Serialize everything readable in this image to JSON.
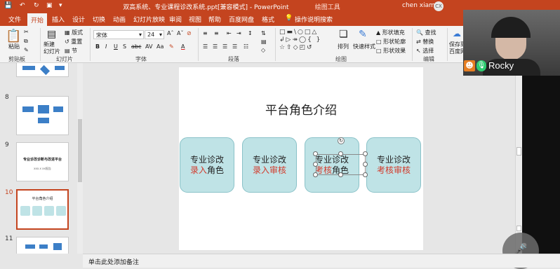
{
  "window": {
    "title": "双高系统、专业课程诊改系统.ppt[兼容模式] - PowerPoint",
    "contextual_tab": "绘图工具",
    "user": "chen xiamei",
    "user_initials": "CX"
  },
  "tabs": [
    "文件",
    "开始",
    "插入",
    "设计",
    "切换",
    "动画",
    "幻灯片放映",
    "审阅",
    "视图",
    "帮助",
    "百度网盘",
    "格式"
  ],
  "tell_me": "操作说明搜索",
  "ribbon": {
    "clipboard": {
      "label": "剪贴板",
      "paste": "粘贴"
    },
    "slides": {
      "label": "幻灯片",
      "new_slide": "新建\n幻灯片",
      "layout": "版式",
      "reset": "重置",
      "section": "节"
    },
    "font": {
      "label": "字体",
      "font_name": "宋体",
      "font_size": "24"
    },
    "paragraph": {
      "label": "段落"
    },
    "drawing": {
      "label": "绘图",
      "arrange": "排列",
      "quick_styles": "快速样式",
      "fill": "形状填充",
      "outline": "形状轮廓",
      "effects": "形状效果"
    },
    "editing": {
      "label": "编辑",
      "find": "查找",
      "replace": "替换",
      "select": "选择"
    },
    "save_to": "保存到\n百度网"
  },
  "thumbnails": [
    {
      "num": "8"
    },
    {
      "num": "9",
      "title": "专业诊改诊断与改进平台",
      "subtitle": "xxx.x  xx报告"
    },
    {
      "num": "10",
      "title": "平台角色介绍"
    },
    {
      "num": "11"
    }
  ],
  "slide": {
    "title": "平台角色介绍",
    "cards": [
      {
        "line1": "专业诊改",
        "line2_red": "录入",
        "line2_black": "角色"
      },
      {
        "line1": "专业诊改",
        "line2_red": "录入审核",
        "line2_black": ""
      },
      {
        "line1": "专业诊改",
        "line2_red": "考核",
        "line2_black": "角色"
      },
      {
        "line1": "专业诊改",
        "line2_red": "考核审核",
        "line2_black": ""
      }
    ]
  },
  "notes_placeholder": "单击此处添加备注",
  "video": {
    "name": "Rocky"
  },
  "colors": {
    "accent": "#c4441f",
    "card_fill": "#bfe3e6",
    "red_text": "#d33a2b"
  }
}
